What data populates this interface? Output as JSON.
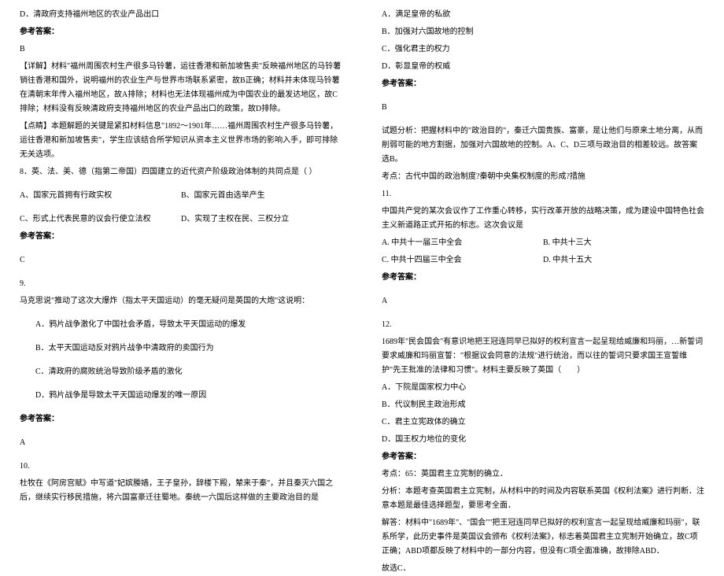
{
  "left": {
    "d_option": "D．清政府支持福州地区的农业产品出口",
    "ref_answer_label": "参考答案：",
    "answer_b": "B",
    "detail": "【详解】材料\"福州周围农村生产很多马铃薯，运往香港和新加坡售卖\"反映福州地区的马铃薯销往香港和国外，说明福州的农业生产与世界市场联系紧密，故B正确；材料并未体现马铃薯在清朝末年传入福州地区，故A排除；材料也无法体现福州成为中国农业的最发达地区，故C排除；材料没有反映清政府支持福州地区的农业产品出口的政策，故D排除。",
    "point": "【点睛】本题解题的关键是紧扣材料信息\"1892～1901年……福州周围农村生产很多马铃薯，运往香港和新加坡售卖\"，学生应该结合所学知识从资本主义世界市场的影响入手，即可排除无关选项。",
    "q8": {
      "stem": "8．英、法、美、德（指第二帝国）四国建立的近代资产阶级政治体制的共同点是（ ）",
      "a": "A、国家元首拥有行政实权",
      "b": "B、国家元首由选举产生",
      "c": "C、形式上代表民意的议会行使立法权",
      "d": "D、实现了主权在民、三权分立",
      "answer": "C"
    },
    "q9": {
      "num": "9.",
      "stem": "马克思说\"推动了这次大爆炸（指太平天国运动）的毫无疑问是英国的大炮\"这说明：",
      "a": "A．鸦片战争激化了中国社会矛盾，导致太平天国运动的爆发",
      "b": "B．太平天国运动反对鸦片战争中清政府的卖国行为",
      "c": "C．清政府的腐败统治导致阶级矛盾的激化",
      "d": "D．鸦片战争是导致太平天国运动爆发的唯一原因",
      "answer": "A"
    },
    "q10": {
      "num": "10.",
      "stem": "杜牧在《阿房宫赋》中写道\"妃嫔媵嫱，王子皇孙，辞楼下殿，辇来于秦\"，并且秦灭六国之后，继续实行移民措施，将六国富豪迁往蜀地。秦统一六国后这样做的主要政治目的是"
    }
  },
  "right": {
    "q10_options": {
      "a": "A．满足皇帝的私欲",
      "b": "B．加强对六国故地的控制",
      "c": "C．强化君主的权力",
      "d": "D．彰显皇帝的权威"
    },
    "ref_answer_label": "参考答案：",
    "q10_answer": "B",
    "q10_analysis": "试题分析：把握材料中的\"政治目的\"，秦迁六国贵族、富豪，是让他们与原来土地分离，从而削弱可能的地方割据，加强对六国故地的控制。A、C、D三项与政治目的相差较远。故答案选B。",
    "q10_point": "考点：古代中国的政治制度?秦朝中央集权制度的形成?措施",
    "q11": {
      "num": "11.",
      "stem": "中国共产党的某次会议作了工作重心转移，实行改革开放的战略决策，成为建设中国特色社会主义新道路正式开拓的标志。这次会议是",
      "a": "A. 中共十一届三中全会",
      "b": "B. 中共十三大",
      "c": "C. 中共十四届三中全会",
      "d": "D. 中共十五大",
      "answer": "A"
    },
    "q12": {
      "num": "12.",
      "stem": "1689年\"民会国会\"有意识地把王冠连同早已拟好的权利宣言一起呈现给威廉和玛丽，…新誓词要求威廉和玛丽宣誓：\"根据议会同意的法规\"进行统治，而以往的誓词只要求国王宣誓维护\"先王批准的法律和习惯\"。材料主要反映了英国（　　）",
      "a": "A．下院是国家权力中心",
      "b": "B．代议制民主政治形成",
      "c": "C．君主立宪政体的确立",
      "d": "D．国王权力地位的变化",
      "answer_label": "参考答案：",
      "point": "考点：65：英国君主立宪制的确立．",
      "analysis": "分析：本题考查英国君主立宪制，从材料中的时间及内容联系英国《权利法案》进行判断．注意本题是最佳选择题型，要思考全面．",
      "solve": "解答：材料中\"1689年\"、\"国会\"\"把王冠连同早已拟好的权利宣言一起呈现给威廉和玛丽\"，联系所学，此历史事件是英国议会颁布《权利法案》，标志着英国君主立宪制开始确立，故C项正确；ABD项都反映了材料中的一部分内容，但没有C项全面准确，故排除ABD．",
      "select": "故选C．"
    }
  }
}
